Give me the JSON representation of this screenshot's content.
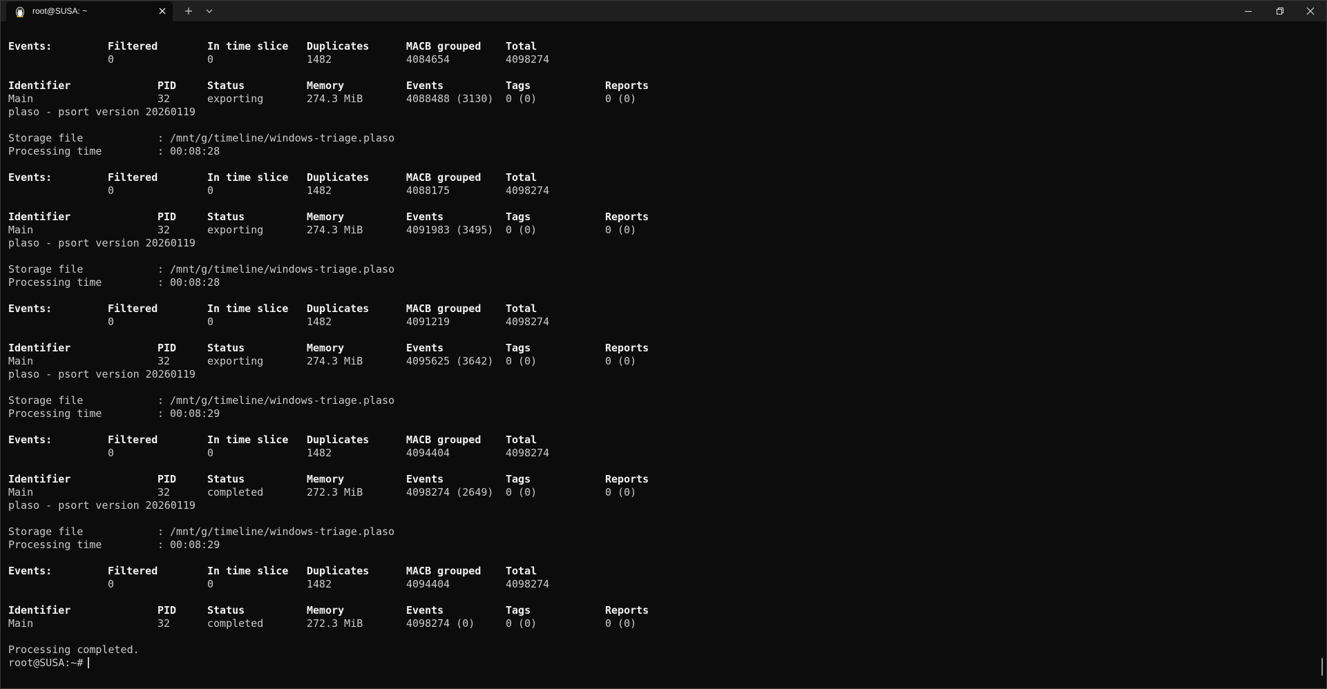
{
  "window": {
    "tab_title": "root@SUSA: ~",
    "icon": "tux-penguin-icon"
  },
  "headers": {
    "events_block": [
      "Events:",
      "Filtered",
      "In time slice",
      "Duplicates",
      "MACB grouped",
      "Total"
    ],
    "process_block": [
      "Identifier",
      "PID",
      "Status",
      "Memory",
      "Events",
      "Tags",
      "Reports"
    ],
    "storage_label": "Storage file",
    "processing_label": "Processing time",
    "separator": ":"
  },
  "blocks": [
    {
      "events": {
        "filtered": "0",
        "in_time_slice": "0",
        "duplicates": "1482",
        "macb_grouped": "4084654",
        "total": "4098274"
      },
      "process": {
        "identifier": "Main",
        "pid": "32",
        "status": "exporting",
        "memory": "274.3 MiB",
        "events": "4088488 (3130)",
        "tags": "0 (0)",
        "reports": "0 (0)"
      }
    },
    {
      "version": "plaso - psort version 20260119",
      "storage_file": "/mnt/g/timeline/windows-triage.plaso",
      "processing_time": "00:08:28",
      "events": {
        "filtered": "0",
        "in_time_slice": "0",
        "duplicates": "1482",
        "macb_grouped": "4088175",
        "total": "4098274"
      },
      "process": {
        "identifier": "Main",
        "pid": "32",
        "status": "exporting",
        "memory": "274.3 MiB",
        "events": "4091983 (3495)",
        "tags": "0 (0)",
        "reports": "0 (0)"
      }
    },
    {
      "version": "plaso - psort version 20260119",
      "storage_file": "/mnt/g/timeline/windows-triage.plaso",
      "processing_time": "00:08:28",
      "events": {
        "filtered": "0",
        "in_time_slice": "0",
        "duplicates": "1482",
        "macb_grouped": "4091219",
        "total": "4098274"
      },
      "process": {
        "identifier": "Main",
        "pid": "32",
        "status": "exporting",
        "memory": "274.3 MiB",
        "events": "4095625 (3642)",
        "tags": "0 (0)",
        "reports": "0 (0)"
      }
    },
    {
      "version": "plaso - psort version 20260119",
      "storage_file": "/mnt/g/timeline/windows-triage.plaso",
      "processing_time": "00:08:29",
      "events": {
        "filtered": "0",
        "in_time_slice": "0",
        "duplicates": "1482",
        "macb_grouped": "4094404",
        "total": "4098274"
      },
      "process": {
        "identifier": "Main",
        "pid": "32",
        "status": "completed",
        "memory": "272.3 MiB",
        "events": "4098274 (2649)",
        "tags": "0 (0)",
        "reports": "0 (0)"
      }
    },
    {
      "version": "plaso - psort version 20260119",
      "storage_file": "/mnt/g/timeline/windows-triage.plaso",
      "processing_time": "00:08:29",
      "events": {
        "filtered": "0",
        "in_time_slice": "0",
        "duplicates": "1482",
        "macb_grouped": "4094404",
        "total": "4098274"
      },
      "process": {
        "identifier": "Main",
        "pid": "32",
        "status": "completed",
        "memory": "272.3 MiB",
        "events": "4098274 (0)",
        "tags": "0 (0)",
        "reports": "0 (0)"
      }
    }
  ],
  "footer": {
    "completed_message": "Processing completed.",
    "prompt": "root@SUSA:~#"
  }
}
